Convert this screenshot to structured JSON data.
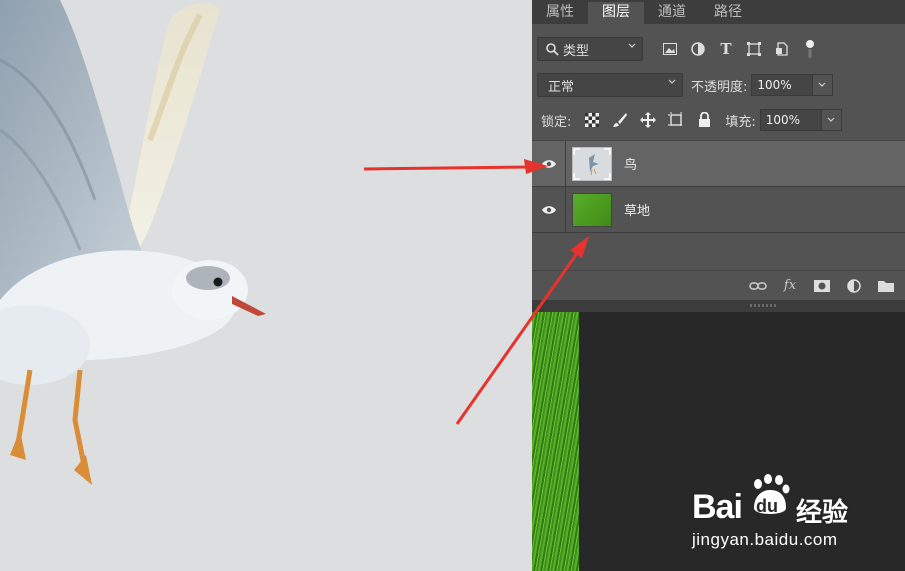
{
  "tabs": [
    {
      "label": "属性",
      "active": false
    },
    {
      "label": "图层",
      "active": true
    },
    {
      "label": "通道",
      "active": false
    },
    {
      "label": "路径",
      "active": false
    }
  ],
  "filter": {
    "kind_label": "类型",
    "icons": [
      "image-filter-icon",
      "adjustment-filter-icon",
      "type-filter-icon",
      "shape-filter-icon",
      "smart-object-filter-icon",
      "filter-toggle-icon"
    ]
  },
  "blend": {
    "mode": "正常",
    "opacity_label": "不透明度:",
    "opacity_value": "100%"
  },
  "lock": {
    "label": "锁定:",
    "fill_label": "填充:",
    "fill_value": "100%"
  },
  "layers": [
    {
      "name": "鸟",
      "selected": true,
      "thumb": "bird"
    },
    {
      "name": "草地",
      "selected": false,
      "thumb": "grass"
    }
  ],
  "footer_icons": [
    "link-layers-icon",
    "fx-icon",
    "add-mask-icon",
    "adjustment-layer-icon",
    "group-folder-icon"
  ],
  "fx_label": "fx",
  "watermark": {
    "brand": "Bai",
    "brand_suffix": "经验",
    "du": "du",
    "url": "jingyan.baidu.com"
  },
  "colors": {
    "panel_bg": "#535353",
    "arrow": "#e8322e",
    "grass": "#4fa022"
  }
}
